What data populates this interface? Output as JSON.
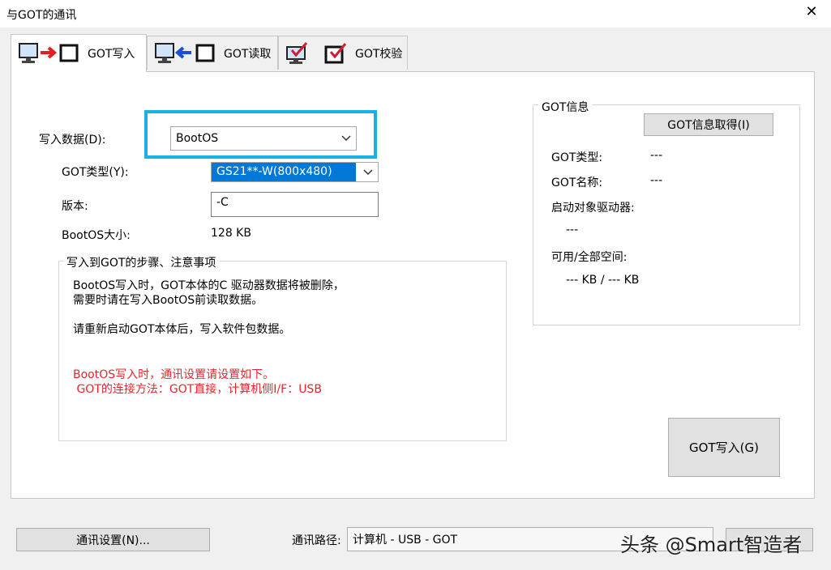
{
  "window": {
    "title": "与GOT的通讯",
    "close_glyph": "✕"
  },
  "tabs": [
    {
      "label": "GOT写入",
      "active": true
    },
    {
      "label": "GOT读取",
      "active": false
    },
    {
      "label": "GOT校验",
      "active": false
    }
  ],
  "form": {
    "write_data_label": "写入数据(D):",
    "write_data_value": "BootOS",
    "got_type_label": "GOT类型(Y):",
    "got_type_value": "GS21**-W(800x480)",
    "version_label": "版本:",
    "version_value": "-C",
    "size_label": "BootOS大小:",
    "size_value": "128 KB"
  },
  "notes": {
    "title": "写入到GOT的步骤、注意事项",
    "line1": "BootOS写入时，GOT本体的C 驱动器数据将被删除，",
    "line2": "需要时请在写入BootOS前读取数据。",
    "line3": "请重新启动GOT本体后，写入软件包数据。",
    "red1": "BootOS写入时，通讯设置请设置如下。",
    "red2": " GOT的连接方法：GOT直接，计算机侧I/F：USB"
  },
  "info": {
    "title": "GOT信息",
    "get_button": "GOT信息取得(I)",
    "type_label": "GOT类型:",
    "type_value": "---",
    "name_label": "GOT名称:",
    "name_value": "---",
    "drive_label": "启动对象驱动器:",
    "drive_value": "---",
    "space_label": "可用/全部空间:",
    "space_value": "--- KB / --- KB"
  },
  "write_button": "GOT写入(G)",
  "footer": {
    "comm_settings_button": "通讯设置(N)...",
    "route_label": "通讯路径:",
    "route_value": "计算机 - USB - GOT"
  },
  "watermark": "头条 @Smart智造者",
  "colors": {
    "highlight": "#1ab0e6",
    "red_text": "#e8242b",
    "selection": "#0078d7"
  }
}
